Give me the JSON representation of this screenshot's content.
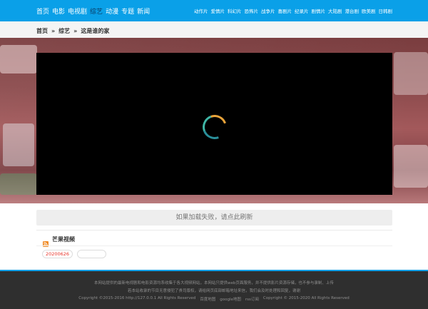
{
  "nav": {
    "main_items": [
      {
        "label": "首页",
        "active": false
      },
      {
        "label": "电影",
        "active": false
      },
      {
        "label": "电视剧",
        "active": false
      },
      {
        "label": "综艺",
        "active": true
      },
      {
        "label": "动漫",
        "active": false
      },
      {
        "label": "专题",
        "active": false
      },
      {
        "label": "新闻",
        "active": false
      }
    ],
    "genre_items": [
      "动作片",
      "爱情片",
      "科幻片",
      "恐怖片",
      "战争片",
      "喜剧片",
      "纪录片",
      "剧情片",
      "大陆剧",
      "港台剧",
      "欧美剧",
      "日韩剧"
    ]
  },
  "breadcrumb": {
    "home": "首页",
    "separator": "»",
    "category": "综艺",
    "title": "这是谁的家"
  },
  "player": {
    "loading": true
  },
  "reload_text": "如果加载失败，请点此刷新",
  "source": {
    "title": "芒果视频",
    "episodes": [
      "20200626",
      ""
    ]
  },
  "footer": {
    "line1": "本网站提供的最新电视剧和电影资源均系收集于各大视频网站，本网站只提供web页面服务，并不提供影片资源存储，也不参与录制、上传",
    "line2": "若本站收录的节目无意侵犯了贵司版权，请给网页底部邮箱地址来信，我们会及时处理和回复，谢谢",
    "links": [
      "Copyright ©2015-2016 http://127.0.0.1 All Rights Reserved",
      "百度地图",
      "google地图",
      "rss订阅",
      "Copyright © 2015-2020 All Rights Reserved"
    ]
  },
  "colors": {
    "brand": "#0aa0e8",
    "footer_bg": "#2f2f2f",
    "active_episode": "#e8342a"
  }
}
